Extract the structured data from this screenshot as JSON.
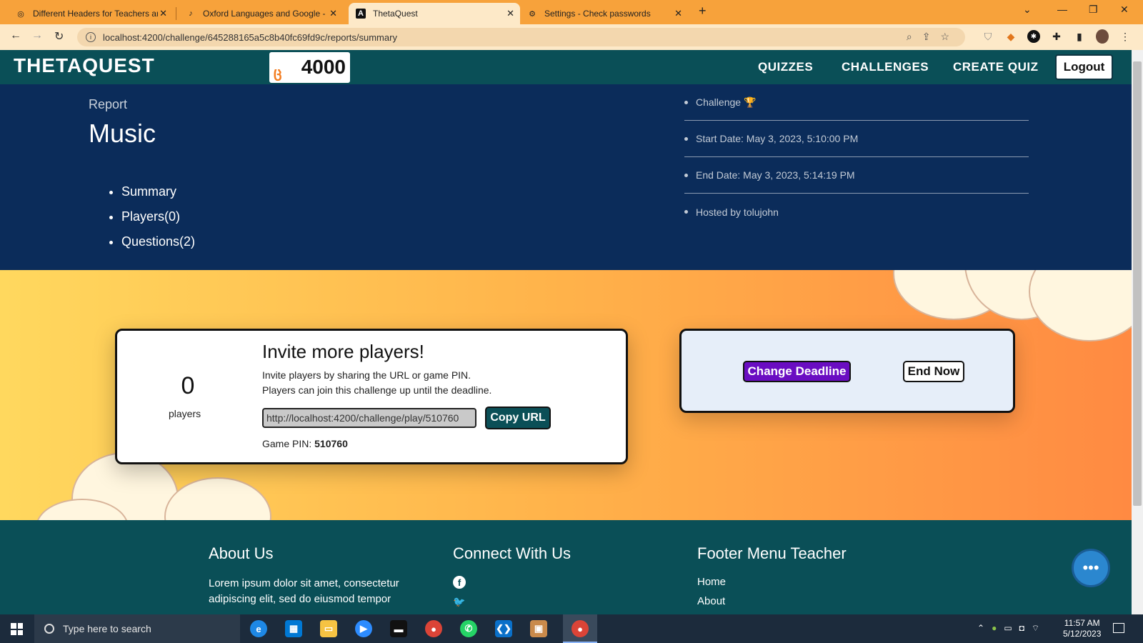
{
  "browser": {
    "tabs": [
      {
        "label": "Different Headers for Teachers ar",
        "icon": "globe-icon"
      },
      {
        "label": "Oxford Languages and Google -",
        "icon": "oxford-icon"
      },
      {
        "label": "ThetaQuest",
        "icon": "angular-icon"
      },
      {
        "label": "Settings - Check passwords",
        "icon": "gear-icon"
      }
    ],
    "url": "localhost:4200/challenge/645288165a5c8b40fc69fd9c/reports/summary"
  },
  "nav": {
    "logo": "THETAQUEST",
    "score": "4000",
    "links": [
      "QUIZZES",
      "CHALLENGES",
      "CREATE QUIZ"
    ],
    "logout": "Logout"
  },
  "hero": {
    "report_label": "Report",
    "title": "Music",
    "menu": [
      "Summary",
      "Players(0)",
      "Questions(2)"
    ],
    "info": [
      "Challenge 🏆",
      "Start Date: May 3, 2023, 5:10:00 PM",
      "End Date: May 3, 2023, 5:14:19 PM",
      "Hosted by tolujohn"
    ]
  },
  "invite": {
    "count": "0",
    "count_label": "players",
    "heading": "Invite more players!",
    "line1": "Invite players by sharing the URL or game PIN.",
    "line2": "Players can join this challenge up until the deadline.",
    "url": "http://localhost:4200/challenge/play/510760",
    "copy_label": "Copy URL",
    "pin_label": "Game PIN:",
    "pin": "510760"
  },
  "actions": {
    "change_deadline": "Change Deadline",
    "end_now": "End Now"
  },
  "footer": {
    "about_title": "About Us",
    "about_text": "Lorem ipsum dolor sit amet, consectetur adipiscing elit, sed do eiusmod tempor",
    "connect_title": "Connect With Us",
    "menu_title": "Footer Menu Teacher",
    "menu_links": [
      "Home",
      "About"
    ]
  },
  "taskbar": {
    "search_placeholder": "Type here to search",
    "time": "11:57 AM",
    "date": "5/12/2023"
  },
  "colors": {
    "nav_bg": "#0a4f57",
    "hero_bg": "#0b2c5a",
    "deadline_btn": "#6a0dc2",
    "tabbar": "#f7a23b"
  }
}
